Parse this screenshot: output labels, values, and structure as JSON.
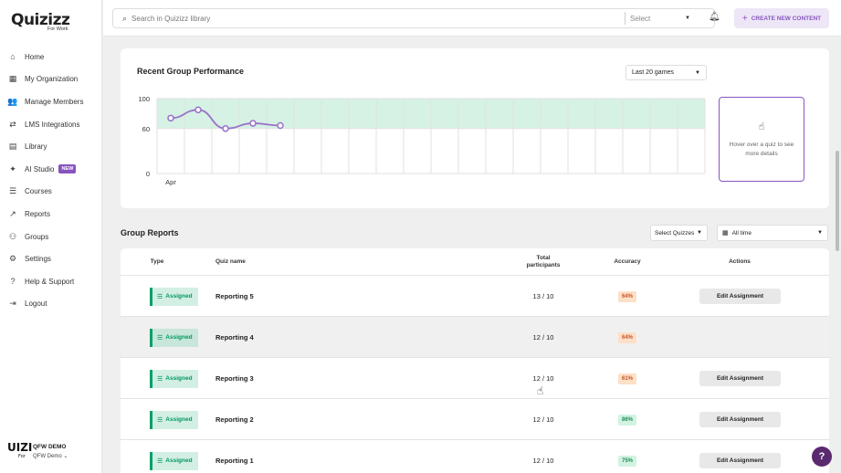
{
  "brand": {
    "name": "Quizizz",
    "sub": "For Work"
  },
  "sidebar": {
    "items": [
      {
        "label": "Home",
        "icon": "home-icon",
        "glyph": "⌂"
      },
      {
        "label": "My Organization",
        "icon": "building-icon",
        "glyph": "▦"
      },
      {
        "label": "Manage Members",
        "icon": "users-icon",
        "glyph": "👥"
      },
      {
        "label": "LMS Integrations",
        "icon": "integration-icon",
        "glyph": "⇄"
      },
      {
        "label": "Library",
        "icon": "library-icon",
        "glyph": "▤"
      },
      {
        "label": "AI Studio",
        "icon": "sparkle-icon",
        "glyph": "✦",
        "badge": "NEW"
      },
      {
        "label": "Courses",
        "icon": "courses-icon",
        "glyph": "☰"
      },
      {
        "label": "Reports",
        "icon": "reports-icon",
        "glyph": "↗"
      },
      {
        "label": "Groups",
        "icon": "groups-icon",
        "glyph": "⚇"
      },
      {
        "label": "Settings",
        "icon": "gear-icon",
        "glyph": "⚙"
      },
      {
        "label": "Help & Support",
        "icon": "help-icon",
        "glyph": "?"
      },
      {
        "label": "Logout",
        "icon": "logout-icon",
        "glyph": "⇥"
      }
    ],
    "user": {
      "avatar_text": "UIZI",
      "avatar_sub": "For",
      "org": "QFW DEMO",
      "team": "QFW Demo"
    }
  },
  "topbar": {
    "search_placeholder": "Search in Quizizz library",
    "select_label": "Select",
    "create_label": "CREATE NEW CONTENT"
  },
  "performance": {
    "title": "Recent Group Performance",
    "range_label": "Last 20 games",
    "hover_text": "Hover over a quiz to see more details"
  },
  "chart_data": {
    "type": "line",
    "title": "Recent Group Performance",
    "yticks": [
      0,
      60,
      100
    ],
    "ylim": [
      0,
      100
    ],
    "xtick_label": "Apr",
    "band": [
      60,
      100
    ],
    "slots": 20,
    "series": [
      {
        "values": [
          74,
          85,
          60,
          67,
          64
        ]
      }
    ],
    "line_color": "#9a72c8",
    "band_color": "#d5f2e4"
  },
  "reports": {
    "title": "Group Reports",
    "filter_quizzes": "Select Quizzes",
    "filter_time": "All time",
    "columns": {
      "type": "Type",
      "quiz": "Quiz name",
      "participants": "Total participants",
      "accuracy": "Accuracy",
      "actions": "Actions"
    },
    "rows": [
      {
        "type": "Assigned",
        "name": "Reporting 5",
        "participants": "13 / 10",
        "accuracy": "64%",
        "acc_tone": "orange",
        "action": "Edit Assignment"
      },
      {
        "type": "Assigned",
        "name": "Reporting 4",
        "participants": "12 / 10",
        "accuracy": "64%",
        "acc_tone": "orange",
        "action": ""
      },
      {
        "type": "Assigned",
        "name": "Reporting 3",
        "participants": "12 / 10",
        "accuracy": "61%",
        "acc_tone": "orange",
        "action": "Edit Assignment"
      },
      {
        "type": "Assigned",
        "name": "Reporting 2",
        "participants": "12 / 10",
        "accuracy": "86%",
        "acc_tone": "green",
        "action": "Edit Assignment"
      },
      {
        "type": "Assigned",
        "name": "Reporting 1",
        "participants": "12 / 10",
        "accuracy": "75%",
        "acc_tone": "green",
        "action": "Edit Assignment"
      }
    ]
  },
  "help_label": "?"
}
